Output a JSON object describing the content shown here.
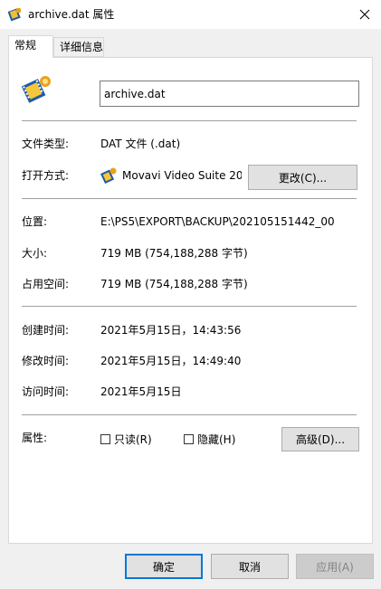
{
  "window": {
    "title": "archive.dat 属性",
    "close_icon": "close-icon"
  },
  "tabs": [
    {
      "label": "常规"
    },
    {
      "label": "详细信息"
    }
  ],
  "file": {
    "name": "archive.dat",
    "icon": "movavi-file-icon"
  },
  "general": {
    "type_label": "文件类型:",
    "type_value": "DAT 文件 (.dat)",
    "opens_with_label": "打开方式:",
    "opens_with_value": "Movavi Video Suite 20",
    "change_button": "更改(C)..."
  },
  "location": {
    "location_label": "位置:",
    "location_value": "E:\\PS5\\EXPORT\\BACKUP\\202105151442_00",
    "size_label": "大小:",
    "size_value": "719 MB (754,188,288 字节)",
    "size_on_disk_label": "占用空间:",
    "size_on_disk_value": "719 MB (754,188,288 字节)"
  },
  "dates": {
    "created_label": "创建时间:",
    "created_value": "2021年5月15日，14:43:56",
    "modified_label": "修改时间:",
    "modified_value": "2021年5月15日，14:49:40",
    "accessed_label": "访问时间:",
    "accessed_value": "2021年5月15日"
  },
  "attributes": {
    "label": "属性:",
    "readonly_label": "只读(R)",
    "readonly_checked": false,
    "hidden_label": "隐藏(H)",
    "hidden_checked": false,
    "advanced_button": "高级(D)..."
  },
  "footer": {
    "ok": "确定",
    "cancel": "取消",
    "apply": "应用(A)"
  },
  "colors": {
    "accent": "#0078d7",
    "background": "#f0f0f0",
    "panel": "#ffffff"
  }
}
